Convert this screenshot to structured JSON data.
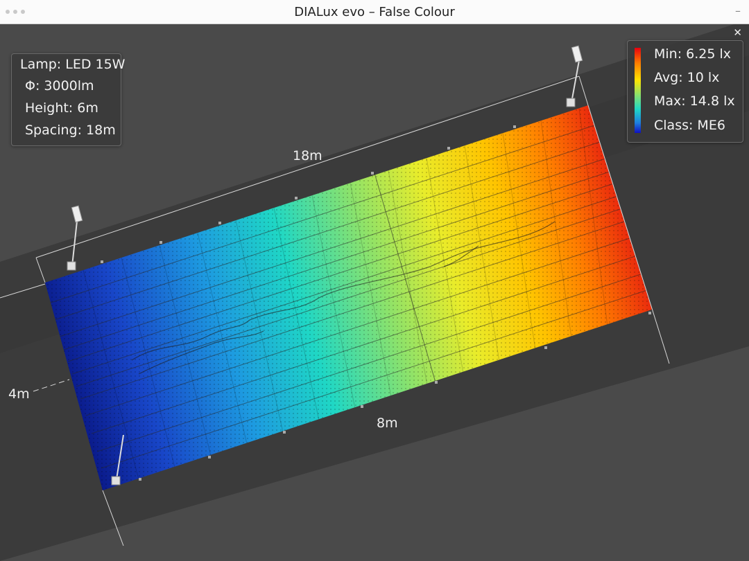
{
  "window": {
    "title": "DIALux evo – False Colour"
  },
  "lamp_info": {
    "lamp": "Lamp: LED 15W",
    "flux": "Φ: 3000lm",
    "height": "Height: 6m",
    "spacing": "Spacing: 18m"
  },
  "stats": {
    "min": "Min: 6.25 lx",
    "avg": "Avg: 10 lx",
    "max": "Max: 14.8 lx",
    "class": "Class: ME6"
  },
  "dimensions": {
    "length": "18m",
    "road_width": "8m",
    "offset": "4m"
  },
  "colors": {
    "background": "#4a4a4a",
    "road": "#3b3b3b",
    "scale_low": "#1010c0",
    "scale_mid": "#ffe400",
    "scale_high": "#e8000e"
  },
  "icons": {
    "close": "close-icon",
    "minimize": "minimize-icon",
    "luminaire": "luminaire-icon"
  }
}
